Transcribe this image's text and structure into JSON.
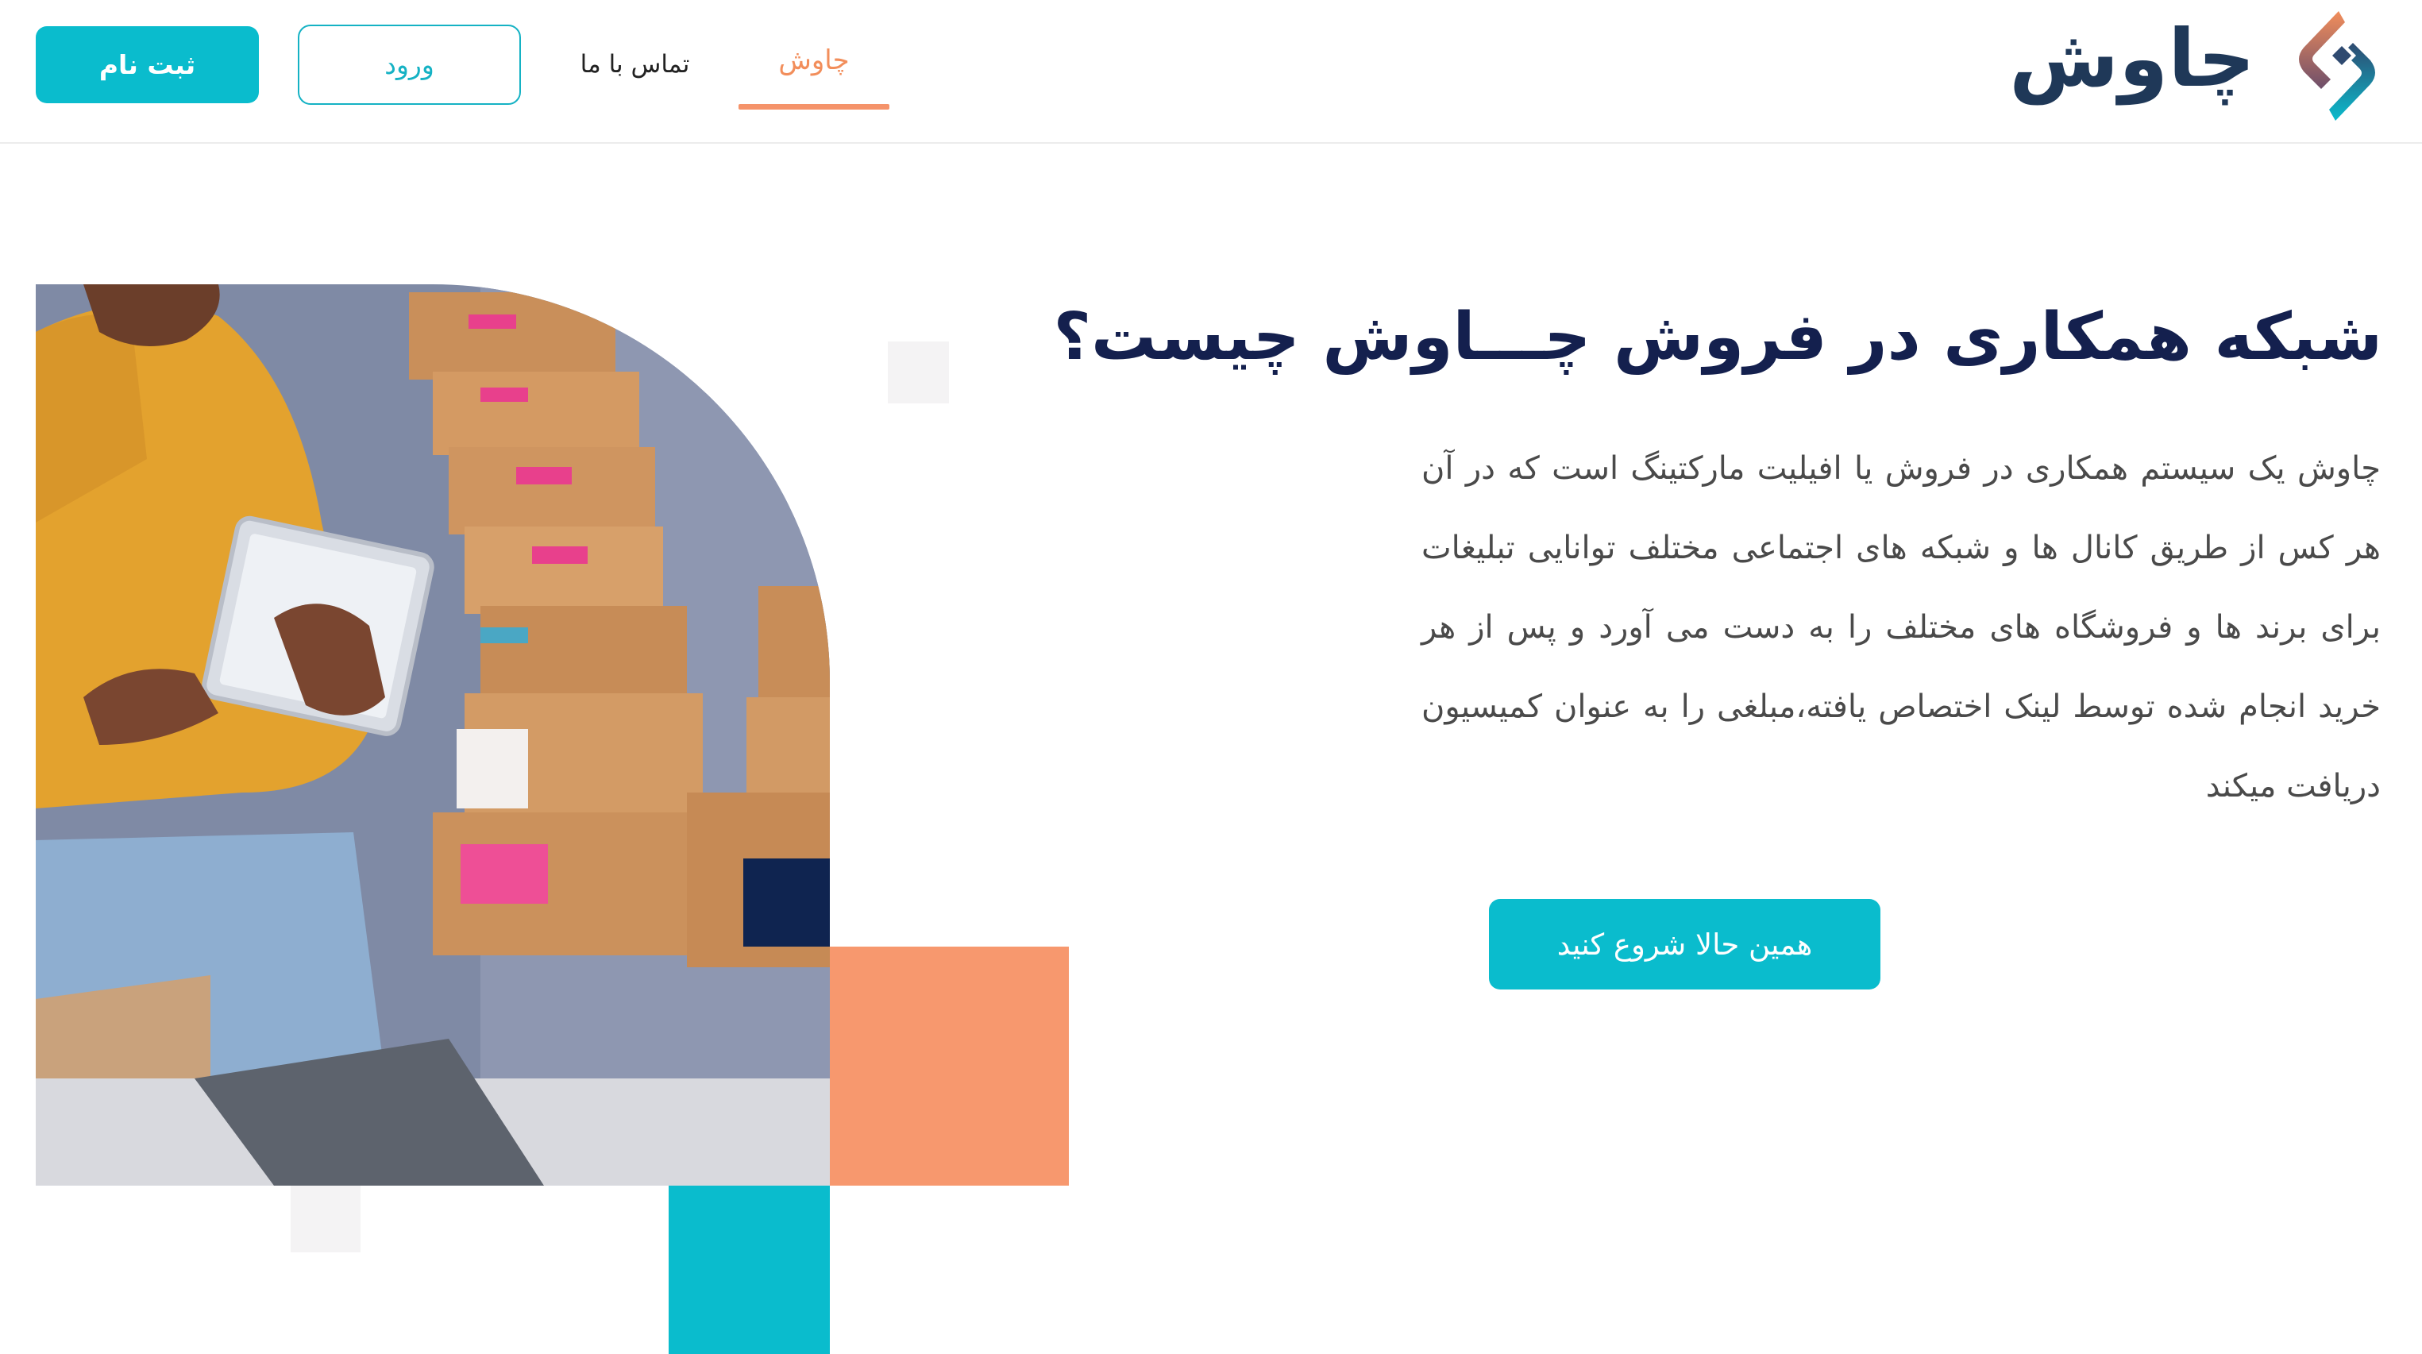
{
  "header": {
    "logo_text": "چاوش",
    "register_label": "ثبت نام",
    "login_label": "ورود",
    "nav": {
      "contact_label": "تماس با ما",
      "home_label": "چاوش"
    }
  },
  "hero": {
    "title": "شبکه همکاری در فروش چـــاوش چیست؟",
    "body": "چاوش یک سیستم همکاری در فروش یا افیلیت مارکتینگ است که در آن هر کس از طریق کانال ها و شبکه های اجتماعی مختلف توانایی تبلیغات برای برند ها و فروشگاه های مختلف را به دست می آورد و پس از هر خرید انجام شده توسط لینک اختصاص یافته،مبلغی را به عنوان کمیسیون دریافت میکند",
    "cta_label": "همین حالا شروع کنید"
  },
  "colors": {
    "primary": "#0abccd",
    "accent": "#f5936a",
    "navy": "#14204e",
    "dark_square": "#0f2450",
    "light_square": "#f4f3f4"
  },
  "icons": {
    "logo_mark": "chavosh-logo-icon"
  }
}
